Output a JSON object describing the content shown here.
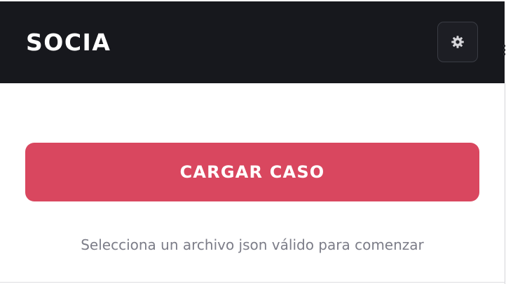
{
  "app": {
    "brand": "SOCIA"
  },
  "header": {
    "settings_icon": "gear-icon"
  },
  "main": {
    "load_button_label": "CARGAR CASO",
    "hint_text": "Selecciona un archivo json válido para comenzar"
  },
  "colors": {
    "header_bg": "#17181d",
    "accent": "#d9475f",
    "hint_text": "#7c7d88"
  }
}
